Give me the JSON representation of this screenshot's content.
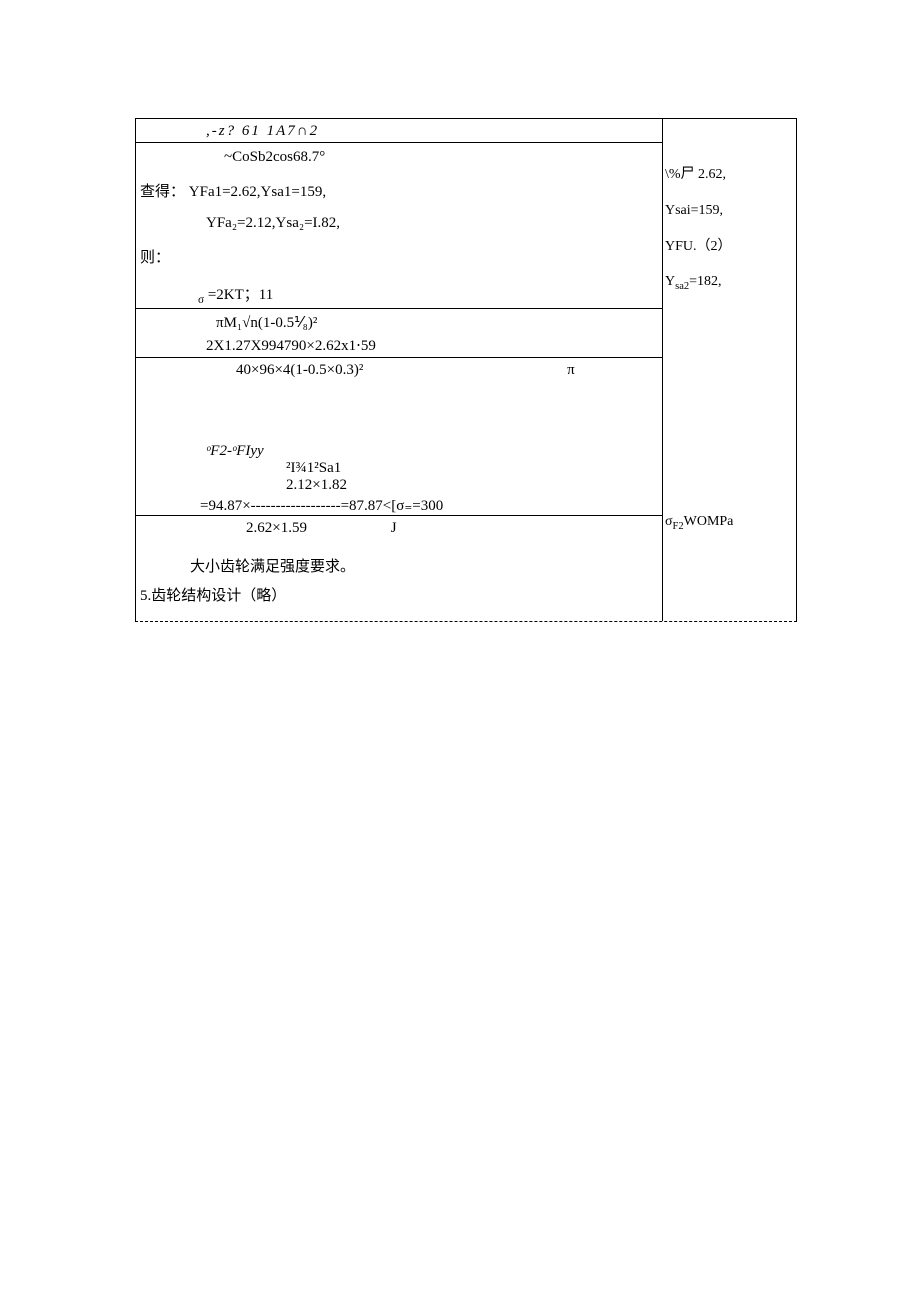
{
  "top_row": ",-z?                61       1A7∩2",
  "cos_line": "~CoSb2cos68.7°",
  "lookup_label": "查得：",
  "yfa1_line": "YFa1=2.62,Ysa1=159,",
  "yfa2_line": "YFa₂=2.12,Ysa₂=I.82,",
  "then_label": "则：",
  "sigma_eq_left": "σ",
  "sigma_eq_right": "=2KT；11",
  "denom1": "πM₁√n(1-0.5⅟₈)²",
  "numer2": "2X1.27X994790×2.62x1⋅59",
  "denom2": "40×96×4(1-0.5×0.3)²",
  "pi_symbol": "π",
  "sigma_f2_line": "ᵒF2-ᵒFIyy",
  "frac_top": "²I¾1²Sa1",
  "frac_mid": "2.12×1.82",
  "frac_result": "=94.87×------------------=87.87<[σ₌=300",
  "frac_bottom": "2.62×1.59",
  "j_label": "J",
  "conclusion": "大小齿轮满足强度要求。",
  "section5": "5.齿轮结构设计（略）",
  "right": {
    "l1": "\\%尸 2.62,",
    "l2": "Ysai=159,",
    "l3": "YFU.（2）",
    "l4": "Ysa2=182,",
    "gap": "",
    "l5": "σF₂WOMPa"
  }
}
